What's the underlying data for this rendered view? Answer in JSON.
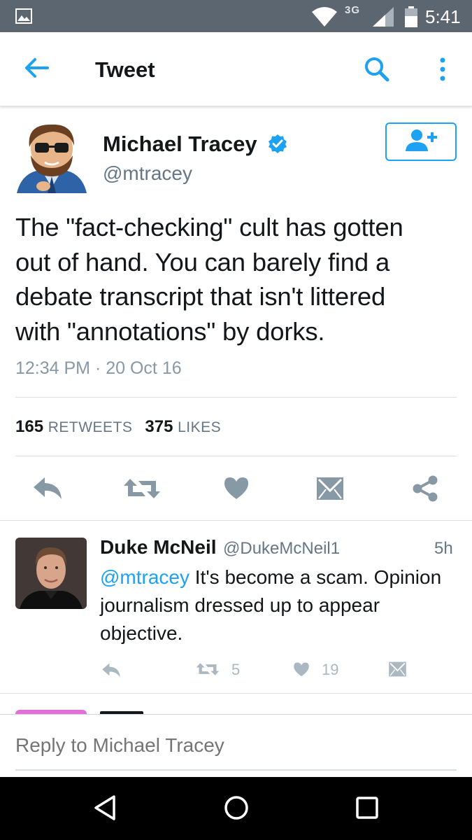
{
  "status_bar": {
    "network": "3G",
    "time": "5:41",
    "icons": [
      "gallery-icon",
      "wifi-icon",
      "signal-icon",
      "battery-icon"
    ]
  },
  "header": {
    "title": "Tweet",
    "icons": [
      "back-arrow-icon",
      "search-icon",
      "more-vertical-icon"
    ]
  },
  "tweet": {
    "author_name": "Michael Tracey",
    "author_handle": "@mtracey",
    "verified": true,
    "text_lines": [
      "The \"fact-checking\" cult has gotten",
      "out of hand. You can barely find a",
      "debate transcript that isn't littered",
      "with \"annotations\" by dorks."
    ],
    "timestamp": "12:34 PM · 20 Oct 16",
    "retweets_count": "165",
    "retweets_label": "RETWEETS",
    "likes_count": "375",
    "likes_label": "LIKES",
    "actions": [
      "reply-icon",
      "retweet-icon",
      "heart-icon",
      "message-icon",
      "share-icon"
    ]
  },
  "reply": {
    "name": "Duke McNeil",
    "handle": "@DukeMcNeil1",
    "time_ago": "5h",
    "mention": "@mtracey",
    "text_rest": " It's become a scam. Opinion journalism dressed up to appear objective.",
    "retweet_count": "5",
    "like_count": "19"
  },
  "reply_bar": {
    "placeholder": "Reply to Michael Tracey"
  },
  "nav_bar": {
    "icons": [
      "back-triangle-icon",
      "home-circle-icon",
      "recents-square-icon"
    ]
  },
  "colors": {
    "accent": "#1da1f2",
    "status_bar": "#5c6670",
    "icon_gray": "#8899a6",
    "text": "#14171a"
  }
}
